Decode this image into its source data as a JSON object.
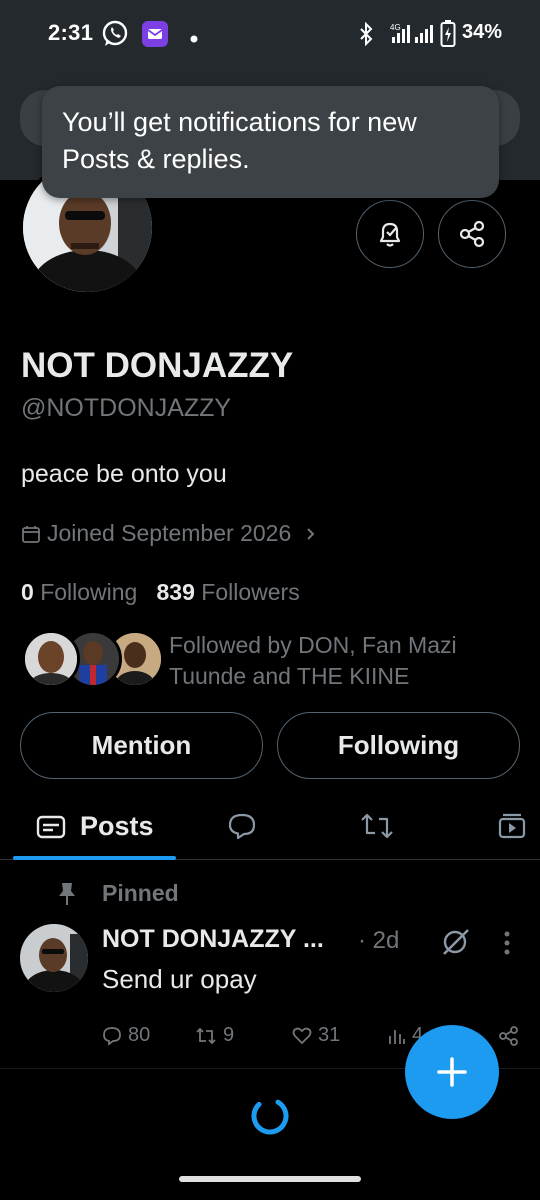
{
  "status_bar": {
    "time": "2:31",
    "battery": "34%",
    "network": "4G",
    "icons": [
      "whatsapp-icon",
      "mail-icon",
      "dot-icon",
      "bluetooth-icon",
      "signal-icon",
      "signal-icon",
      "battery-icon"
    ]
  },
  "toast": {
    "text": "You’ll get notifications for new Posts & replies."
  },
  "profile": {
    "display_name": "NOT DONJAZZY",
    "handle": "@NOTDONJAZZY",
    "bio": "peace be onto you",
    "joined": "Joined September 2026",
    "following_count": "0",
    "following_label": "Following",
    "followers_count": "839",
    "followers_label": "Followers",
    "followed_by": "Followed by DON, Fan Mazi Tuunde and THE KIINE"
  },
  "buttons": {
    "mention": "Mention",
    "following": "Following"
  },
  "tabs": [
    {
      "label": "Posts",
      "icon": "posts-icon",
      "selected": true
    },
    {
      "label": "",
      "icon": "reply-icon"
    },
    {
      "label": "",
      "icon": "repost-icon"
    },
    {
      "label": "",
      "icon": "media-icon"
    }
  ],
  "pinned_post": {
    "pinned_label": "Pinned",
    "author": "NOT DONJAZZY ...",
    "time": "· 2d",
    "text": "Send ur opay",
    "replies": "80",
    "reposts": "9",
    "likes": "31",
    "views": "4"
  },
  "colors": {
    "accent": "#1d9bf0",
    "background": "#000000",
    "muted": "#71767b",
    "banner": "#24292e"
  }
}
